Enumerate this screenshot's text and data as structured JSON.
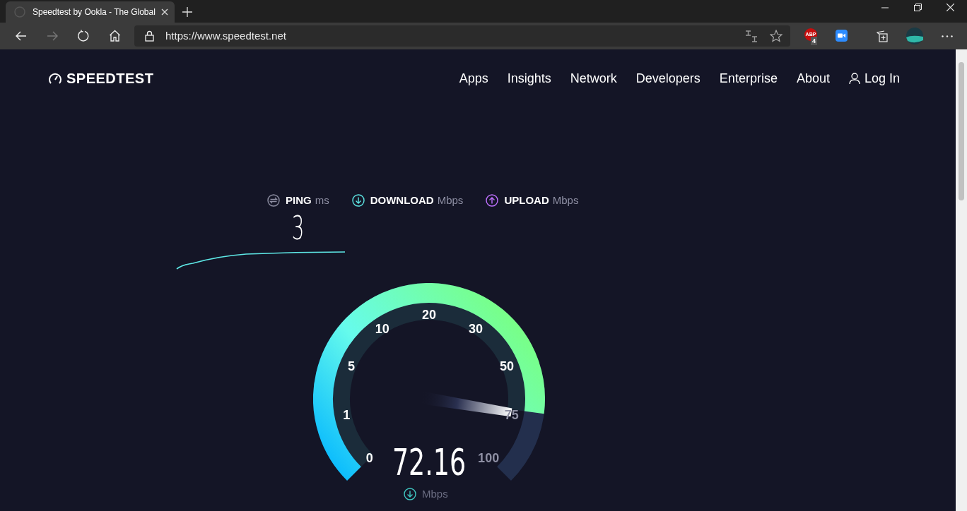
{
  "browser": {
    "tab_title": "Speedtest by Ookla - The Global",
    "address": "https://www.speedtest.net",
    "extension_label": "ABP",
    "extension_badge": "4"
  },
  "site": {
    "logo": "SPEEDTEST",
    "nav": [
      "Apps",
      "Insights",
      "Network",
      "Developers",
      "Enterprise",
      "About"
    ],
    "login": "Log In"
  },
  "results": [
    {
      "kind": "ping",
      "label": "PING",
      "unit": "ms",
      "value": "3"
    },
    {
      "kind": "download",
      "label": "DOWNLOAD",
      "unit": "Mbps"
    },
    {
      "kind": "upload",
      "label": "UPLOAD",
      "unit": "Mbps"
    }
  ],
  "gauge": {
    "reading": "72.16",
    "unit": "Mbps",
    "ticks": [
      {
        "label": "0",
        "reached": true
      },
      {
        "label": "1",
        "reached": true
      },
      {
        "label": "5",
        "reached": true
      },
      {
        "label": "10",
        "reached": true
      },
      {
        "label": "20",
        "reached": true
      },
      {
        "label": "30",
        "reached": true
      },
      {
        "label": "50",
        "reached": true
      },
      {
        "label": "75",
        "reached": false
      },
      {
        "label": "100",
        "reached": false
      }
    ]
  }
}
